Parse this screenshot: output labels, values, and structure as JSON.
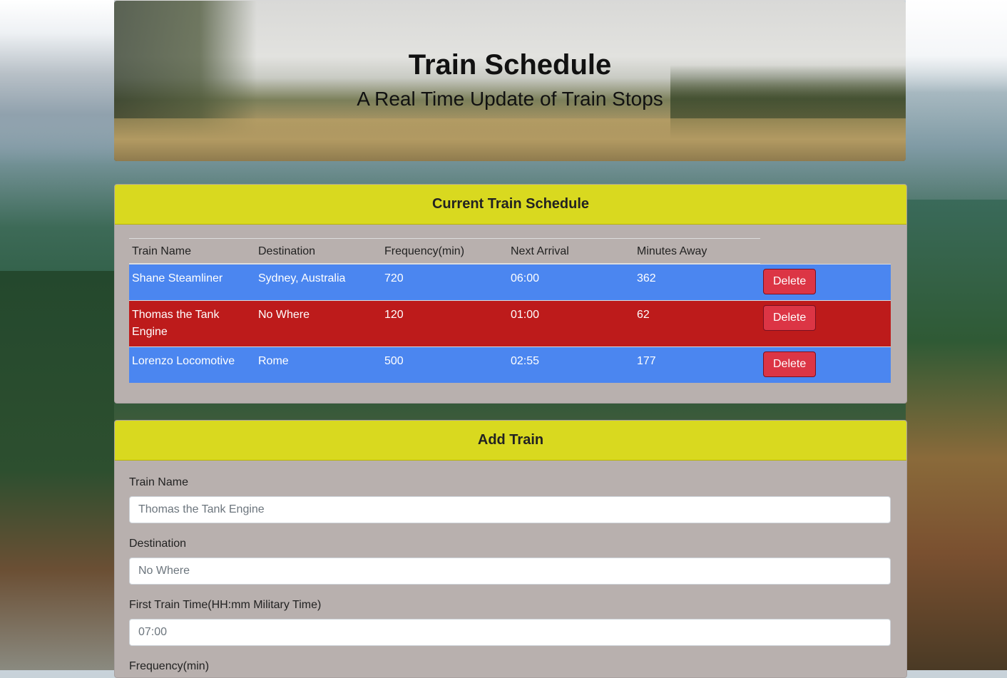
{
  "header": {
    "title": "Train Schedule",
    "subtitle": "A Real Time Update of Train Stops"
  },
  "schedule": {
    "heading": "Current Train Schedule",
    "columns": [
      "Train Name",
      "Destination",
      "Frequency(min)",
      "Next Arrival",
      "Minutes Away"
    ],
    "rows": [
      {
        "name": "Shane Steamliner",
        "destination": "Sydney, Australia",
        "frequency": "720",
        "next_arrival": "06:00",
        "minutes_away": "362",
        "row_color": "#4b86f0",
        "delete_label": "Delete"
      },
      {
        "name": "Thomas the Tank Engine",
        "destination": "No Where",
        "frequency": "120",
        "next_arrival": "01:00",
        "minutes_away": "62",
        "row_color": "#bd1b1b",
        "delete_label": "Delete"
      },
      {
        "name": "Lorenzo Locomotive",
        "destination": "Rome",
        "frequency": "500",
        "next_arrival": "02:55",
        "minutes_away": "177",
        "row_color": "#4b86f0",
        "delete_label": "Delete"
      }
    ]
  },
  "add_train": {
    "heading": "Add Train",
    "fields": [
      {
        "label": "Train Name",
        "placeholder": "Thomas the Tank Engine"
      },
      {
        "label": "Destination",
        "placeholder": "No Where"
      },
      {
        "label": "First Train Time(HH:mm Military Time)",
        "placeholder": "07:00"
      },
      {
        "label": "Frequency(min)",
        "placeholder": ""
      }
    ]
  },
  "colors": {
    "card_header": "#d9d91f",
    "card_body": "#b8b0ae",
    "delete_button": "#dc3545"
  }
}
